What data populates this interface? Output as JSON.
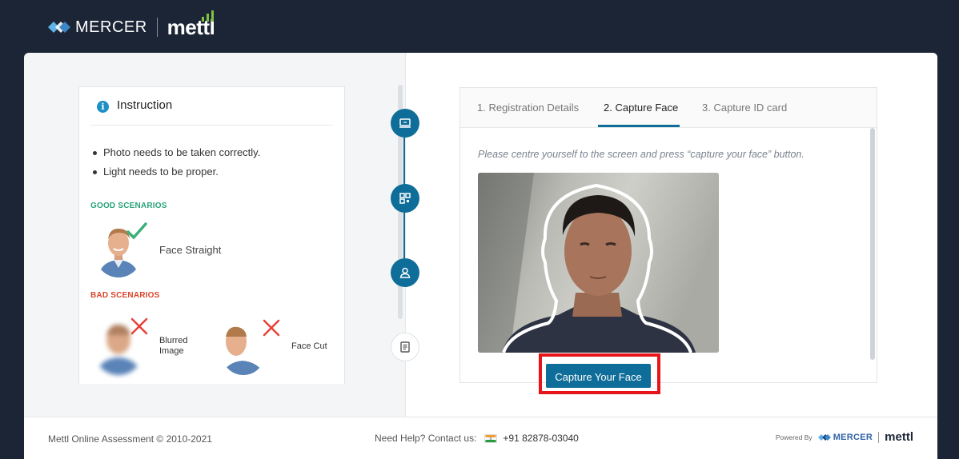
{
  "header": {
    "brand": "MERCER",
    "product": "mettl"
  },
  "instruction": {
    "title": "Instruction",
    "icon": "info-icon",
    "bullets": [
      "Photo needs to be taken correctly.",
      "Light needs to be proper."
    ],
    "good_label": "GOOD SCENARIOS",
    "good_items": [
      {
        "label": "Face Straight"
      }
    ],
    "bad_label": "BAD SCENARIOS",
    "bad_items": [
      {
        "label": "Blurred Image"
      },
      {
        "label": "Face Cut"
      }
    ]
  },
  "stepper": {
    "steps": [
      {
        "icon": "laptop-icon",
        "state": "done"
      },
      {
        "icon": "qr-code-icon",
        "state": "done"
      },
      {
        "icon": "user-icon",
        "state": "active"
      },
      {
        "icon": "document-icon",
        "state": "pending"
      }
    ]
  },
  "tabs": {
    "items": [
      {
        "label": "1. Registration Details"
      },
      {
        "label": "2. Capture Face"
      },
      {
        "label": "3. Capture ID card"
      }
    ],
    "active_index": 1
  },
  "capture": {
    "hint": "Please centre yourself to the screen and press “capture your face” button.",
    "button_label": "Capture Your Face"
  },
  "footer": {
    "copyright": "Mettl Online Assessment © 2010-2021",
    "help_text": "Need Help? Contact us:",
    "phone": "+91 82878-03040",
    "powered_by": "Powered By",
    "powered_brand": "MERCER",
    "powered_product": "mettl"
  },
  "colors": {
    "header_bg": "#1c2535",
    "primary": "#0f6d99",
    "good": "#2aa37a",
    "bad": "#d9462b",
    "highlight": "#e8141b"
  }
}
